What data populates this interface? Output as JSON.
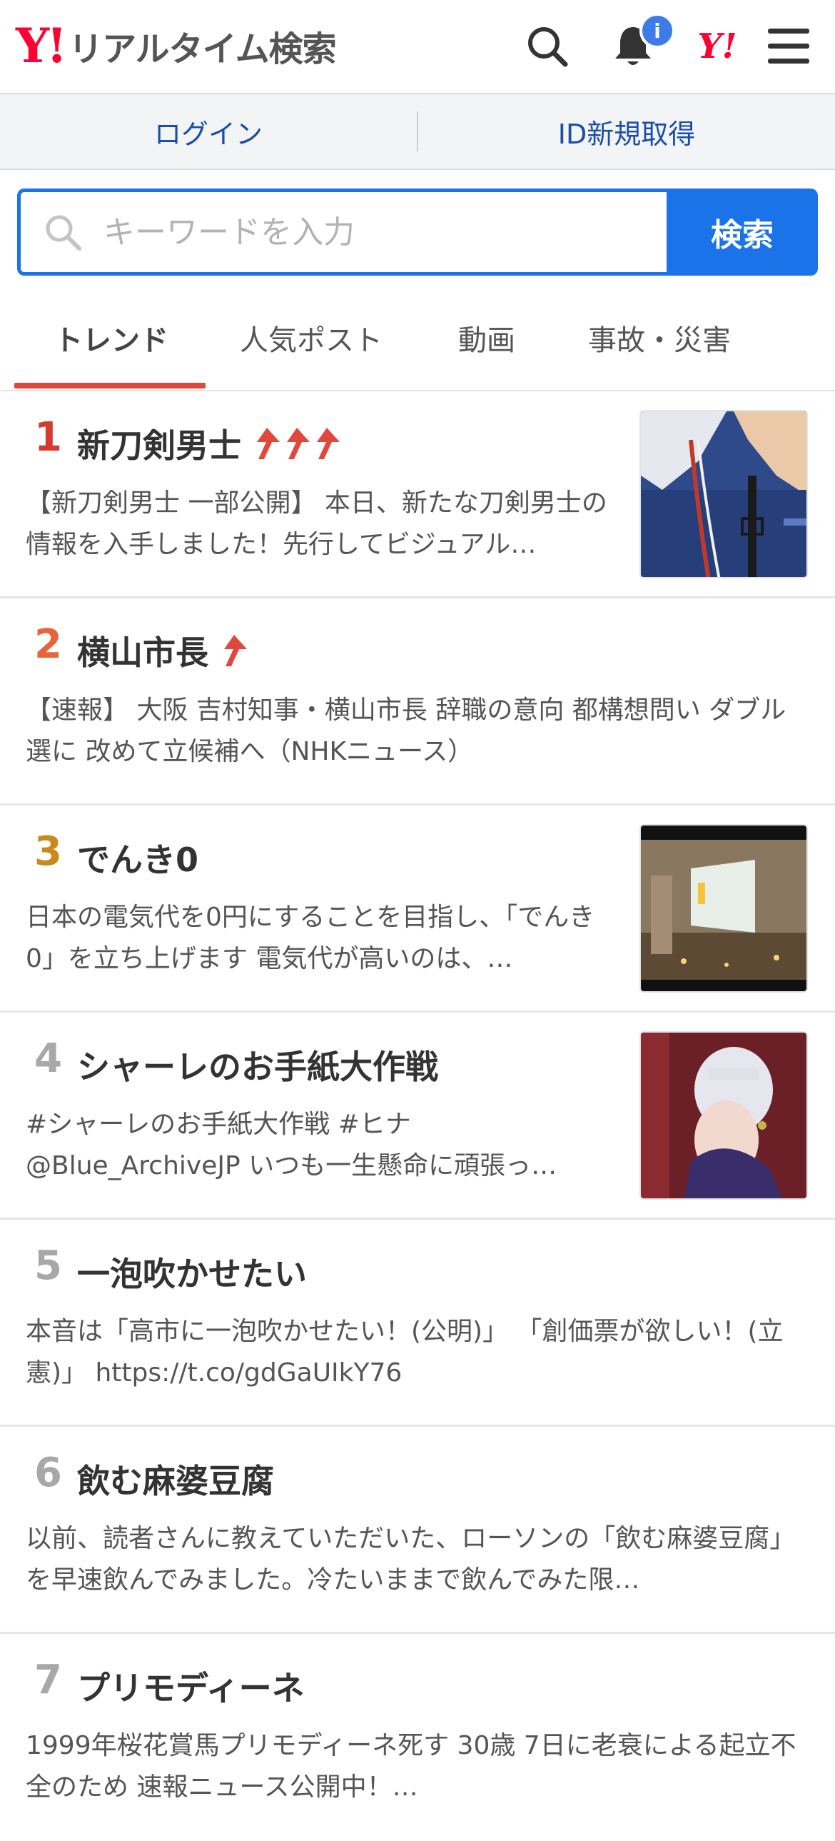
{
  "header": {
    "logo_mark": "Y!",
    "logo_text": "リアルタイム検索",
    "notification_badge": "i",
    "brand_icon": "Y!"
  },
  "login_bar": {
    "login_label": "ログイン",
    "signup_label": "ID新規取得"
  },
  "search": {
    "placeholder": "キーワードを入力",
    "button_label": "検索"
  },
  "tabs": [
    {
      "label": "トレンド",
      "active": true
    },
    {
      "label": "人気ポスト",
      "active": false
    },
    {
      "label": "動画",
      "active": false
    },
    {
      "label": "事故・災害",
      "active": false
    }
  ],
  "trends": [
    {
      "rank": "1",
      "title": "新刀剣男士",
      "arrows": 3,
      "desc": "【新刀剣男士 一部公開】 本日、新たな刀剣男士の情報を入手しました！先行してビジュアル…",
      "thumb": "sword-character-image"
    },
    {
      "rank": "2",
      "title": "横山市長",
      "arrows": 1,
      "desc": "【速報】 大阪 吉村知事・横山市長 辞職の意向 都構想問い ダブル選に 改めて立候補へ（NHKニュース）",
      "thumb": ""
    },
    {
      "rank": "3",
      "title": "でんき0",
      "arrows": 0,
      "desc": "日本の電気代を0円にすることを目指し、「でんき0」を立ち上げます 電気代が高いのは、…",
      "thumb": "billboard-image"
    },
    {
      "rank": "4",
      "title": "シャーレのお手紙大作戦",
      "arrows": 0,
      "desc": "#シャーレのお手紙大作戦 #ヒナ @Blue_ArchiveJP いつも一生懸命に頑張っ…",
      "thumb": "anime-girl-image"
    },
    {
      "rank": "5",
      "title": "一泡吹かせたい",
      "arrows": 0,
      "desc": "本音は「高市に一泡吹かせたい！(公明)」 「創価票が欲しい！(立憲)」 https://t.co/gdGaUIkY76",
      "thumb": ""
    },
    {
      "rank": "6",
      "title": "飲む麻婆豆腐",
      "arrows": 0,
      "desc": "以前、読者さんに教えていただいた、ローソンの「飲む麻婆豆腐」を早速飲んでみました。冷たいままで飲んでみた限…",
      "thumb": ""
    },
    {
      "rank": "7",
      "title": "プリモディーネ",
      "arrows": 0,
      "desc": "1999年桜花賞馬プリモディーネ死す 30歳 7日に老衰による起立不全のため 速報ニュース公開中！…",
      "thumb": ""
    }
  ],
  "colors": {
    "brand_red": "#ff0033",
    "accent_blue": "#1a73e8",
    "rank1": "#d53a2f",
    "rank2": "#e8643a",
    "rank3": "#c88a1a",
    "rank_other": "#a8a8a8"
  }
}
